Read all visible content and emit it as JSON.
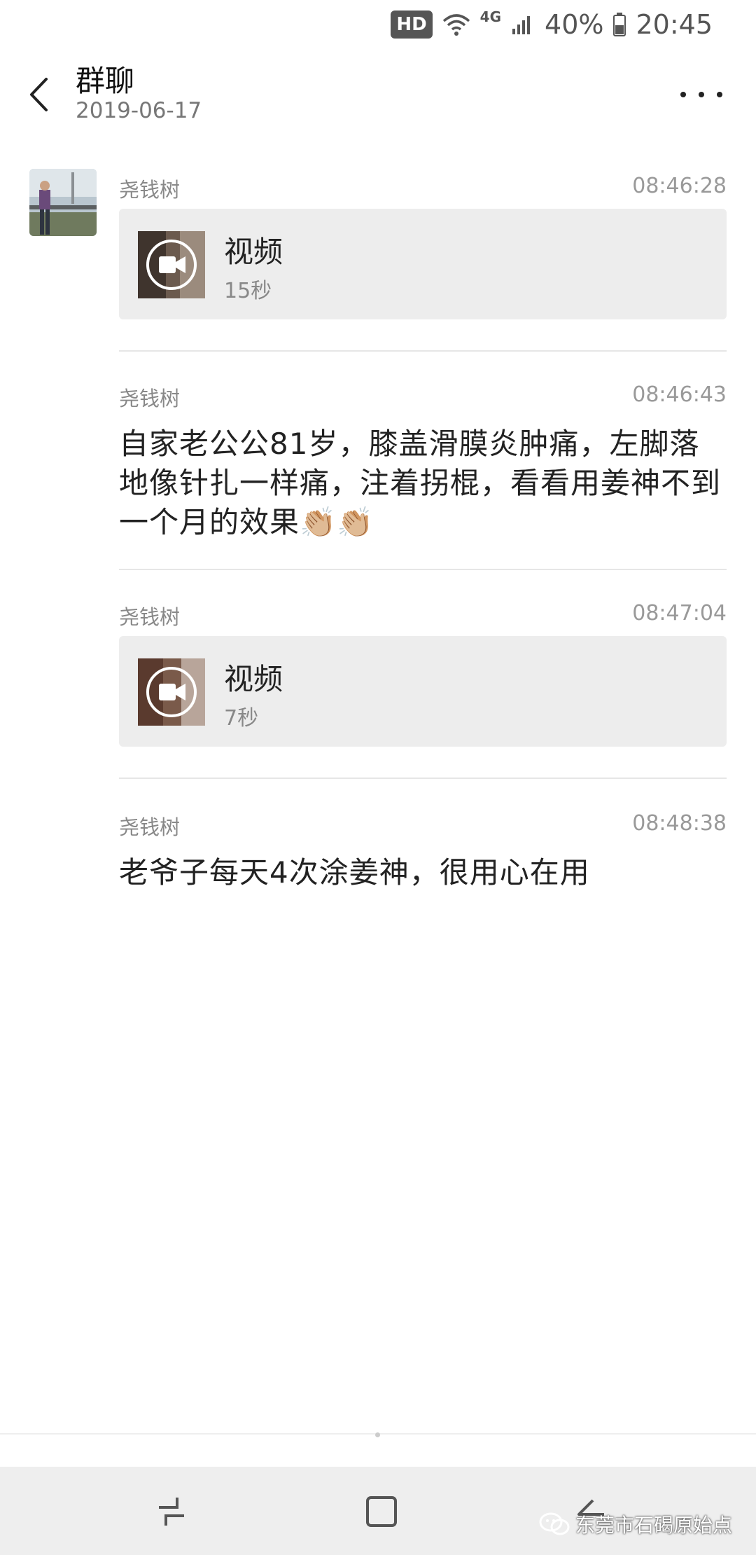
{
  "status_bar": {
    "hd": "HD",
    "network": "4G",
    "battery": "40%",
    "time": "20:45"
  },
  "header": {
    "title": "群聊",
    "date": "2019-06-17"
  },
  "messages": [
    {
      "sender": "尧钱树",
      "time": "08:46:28",
      "type": "video",
      "label": "视频",
      "duration": "15秒"
    },
    {
      "sender": "尧钱树",
      "time": "08:46:43",
      "type": "text",
      "text": "自家老公公81岁，膝盖滑膜炎肿痛，左脚落地像针扎一样痛，注着拐棍，看看用姜神不到一个月的效果👏🏼👏🏼"
    },
    {
      "sender": "尧钱树",
      "time": "08:47:04",
      "type": "video",
      "label": "视频",
      "duration": "7秒"
    },
    {
      "sender": "尧钱树",
      "time": "08:48:38",
      "type": "text",
      "text": "老爷子每天4次涂姜神，很用心在用"
    }
  ],
  "watermark": "东莞市石碣原始点",
  "icons": {
    "back": "chevron-left-icon",
    "more": "more-dots-icon",
    "video": "video-camera-icon",
    "wifi": "wifi-icon",
    "signal": "signal-icon",
    "battery": "battery-icon",
    "nav_recent": "recent-apps-icon",
    "nav_home": "home-icon",
    "nav_back": "back-icon",
    "wechat": "wechat-icon"
  },
  "colors": {
    "card_bg": "#ededed",
    "nav_bg": "#eeeeee",
    "meta_text": "#888888"
  }
}
